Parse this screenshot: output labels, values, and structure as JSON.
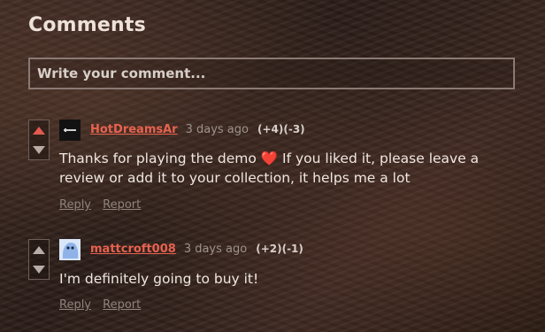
{
  "title": "Comments",
  "comment_input": {
    "placeholder": "Write your comment..."
  },
  "comments": [
    {
      "username": "HotDreamsAr",
      "time_ago": "3 days ago",
      "score": "(+4)(-3)",
      "text_before": "Thanks for playing the demo ",
      "emoji": "❤️",
      "text_after": " If you liked it, please leave a review or add it to your collection, it helps me a lot",
      "reply_label": "Reply",
      "report_label": "Report",
      "upvoted": true,
      "avatar_icon": "dark-logo-avatar"
    },
    {
      "username": "mattcroft008",
      "time_ago": "3 days ago",
      "score": "(+2)(-1)",
      "text": "I'm definitely going to buy it!",
      "reply_label": "Reply",
      "report_label": "Report",
      "upvoted": false,
      "avatar_icon": "blue-blob-avatar"
    }
  ],
  "colors": {
    "username": "#e8624f",
    "upvote_active": "#e25b4e"
  }
}
